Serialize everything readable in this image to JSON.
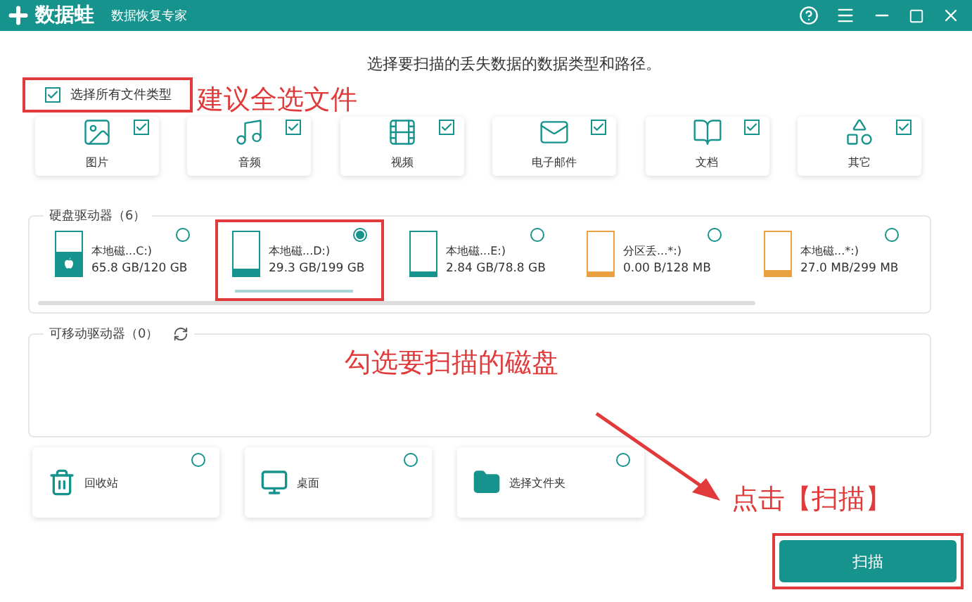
{
  "window": {
    "app_name": "数据蛙",
    "subtitle": "数据恢复专家"
  },
  "prompt": "选择要扫描的丢失数据的数据类型和路径。",
  "select_all": {
    "label": "选择所有文件类型",
    "checked": true,
    "highlighted": true
  },
  "categories": [
    {
      "kind": "image",
      "label": "图片",
      "checked": true
    },
    {
      "kind": "audio",
      "label": "音频",
      "checked": true
    },
    {
      "kind": "video",
      "label": "视频",
      "checked": true
    },
    {
      "kind": "mail",
      "label": "电子邮件",
      "checked": true
    },
    {
      "kind": "document",
      "label": "文档",
      "checked": true
    },
    {
      "kind": "other",
      "label": "其它",
      "checked": true
    }
  ],
  "hard_drives": {
    "title": "硬盘驱动器（6）",
    "items": [
      {
        "kind": "system",
        "name": "本地磁...C:)",
        "size": "65.8 GB/120 GB",
        "level": 0.55,
        "color": "#17938d",
        "selected": false,
        "highlighted": false
      },
      {
        "kind": "disk",
        "name": "本地磁...D:)",
        "size": "29.3 GB/199 GB",
        "level": 0.15,
        "color": "#17938d",
        "selected": true,
        "highlighted": true
      },
      {
        "kind": "disk",
        "name": "本地磁...E:)",
        "size": "2.84 GB/78.8 GB",
        "level": 0.04,
        "color": "#17938d",
        "selected": false,
        "highlighted": false
      },
      {
        "kind": "disk",
        "name": "分区丢...*:)",
        "size": "0.00  B/128 MB",
        "level": 0,
        "color": "#e8a040",
        "selected": false,
        "highlighted": false
      },
      {
        "kind": "disk",
        "name": "本地磁...*:)",
        "size": "27.0 MB/299 MB",
        "level": 0.12,
        "color": "#e8a040",
        "selected": false,
        "highlighted": false
      }
    ]
  },
  "removable_drives": {
    "title": "可移动驱动器（0）"
  },
  "locations": [
    {
      "kind": "recycle",
      "label": "回收站",
      "selected": false
    },
    {
      "kind": "desktop",
      "label": "桌面",
      "selected": false
    },
    {
      "kind": "folder",
      "label": "选择文件夹",
      "selected": false
    }
  ],
  "scan_button": {
    "label": "扫描",
    "highlighted": true
  },
  "notes": {
    "select_all": "建议全选文件",
    "drives": "勾选要扫描的磁盘",
    "scan": "点击【扫描】"
  }
}
